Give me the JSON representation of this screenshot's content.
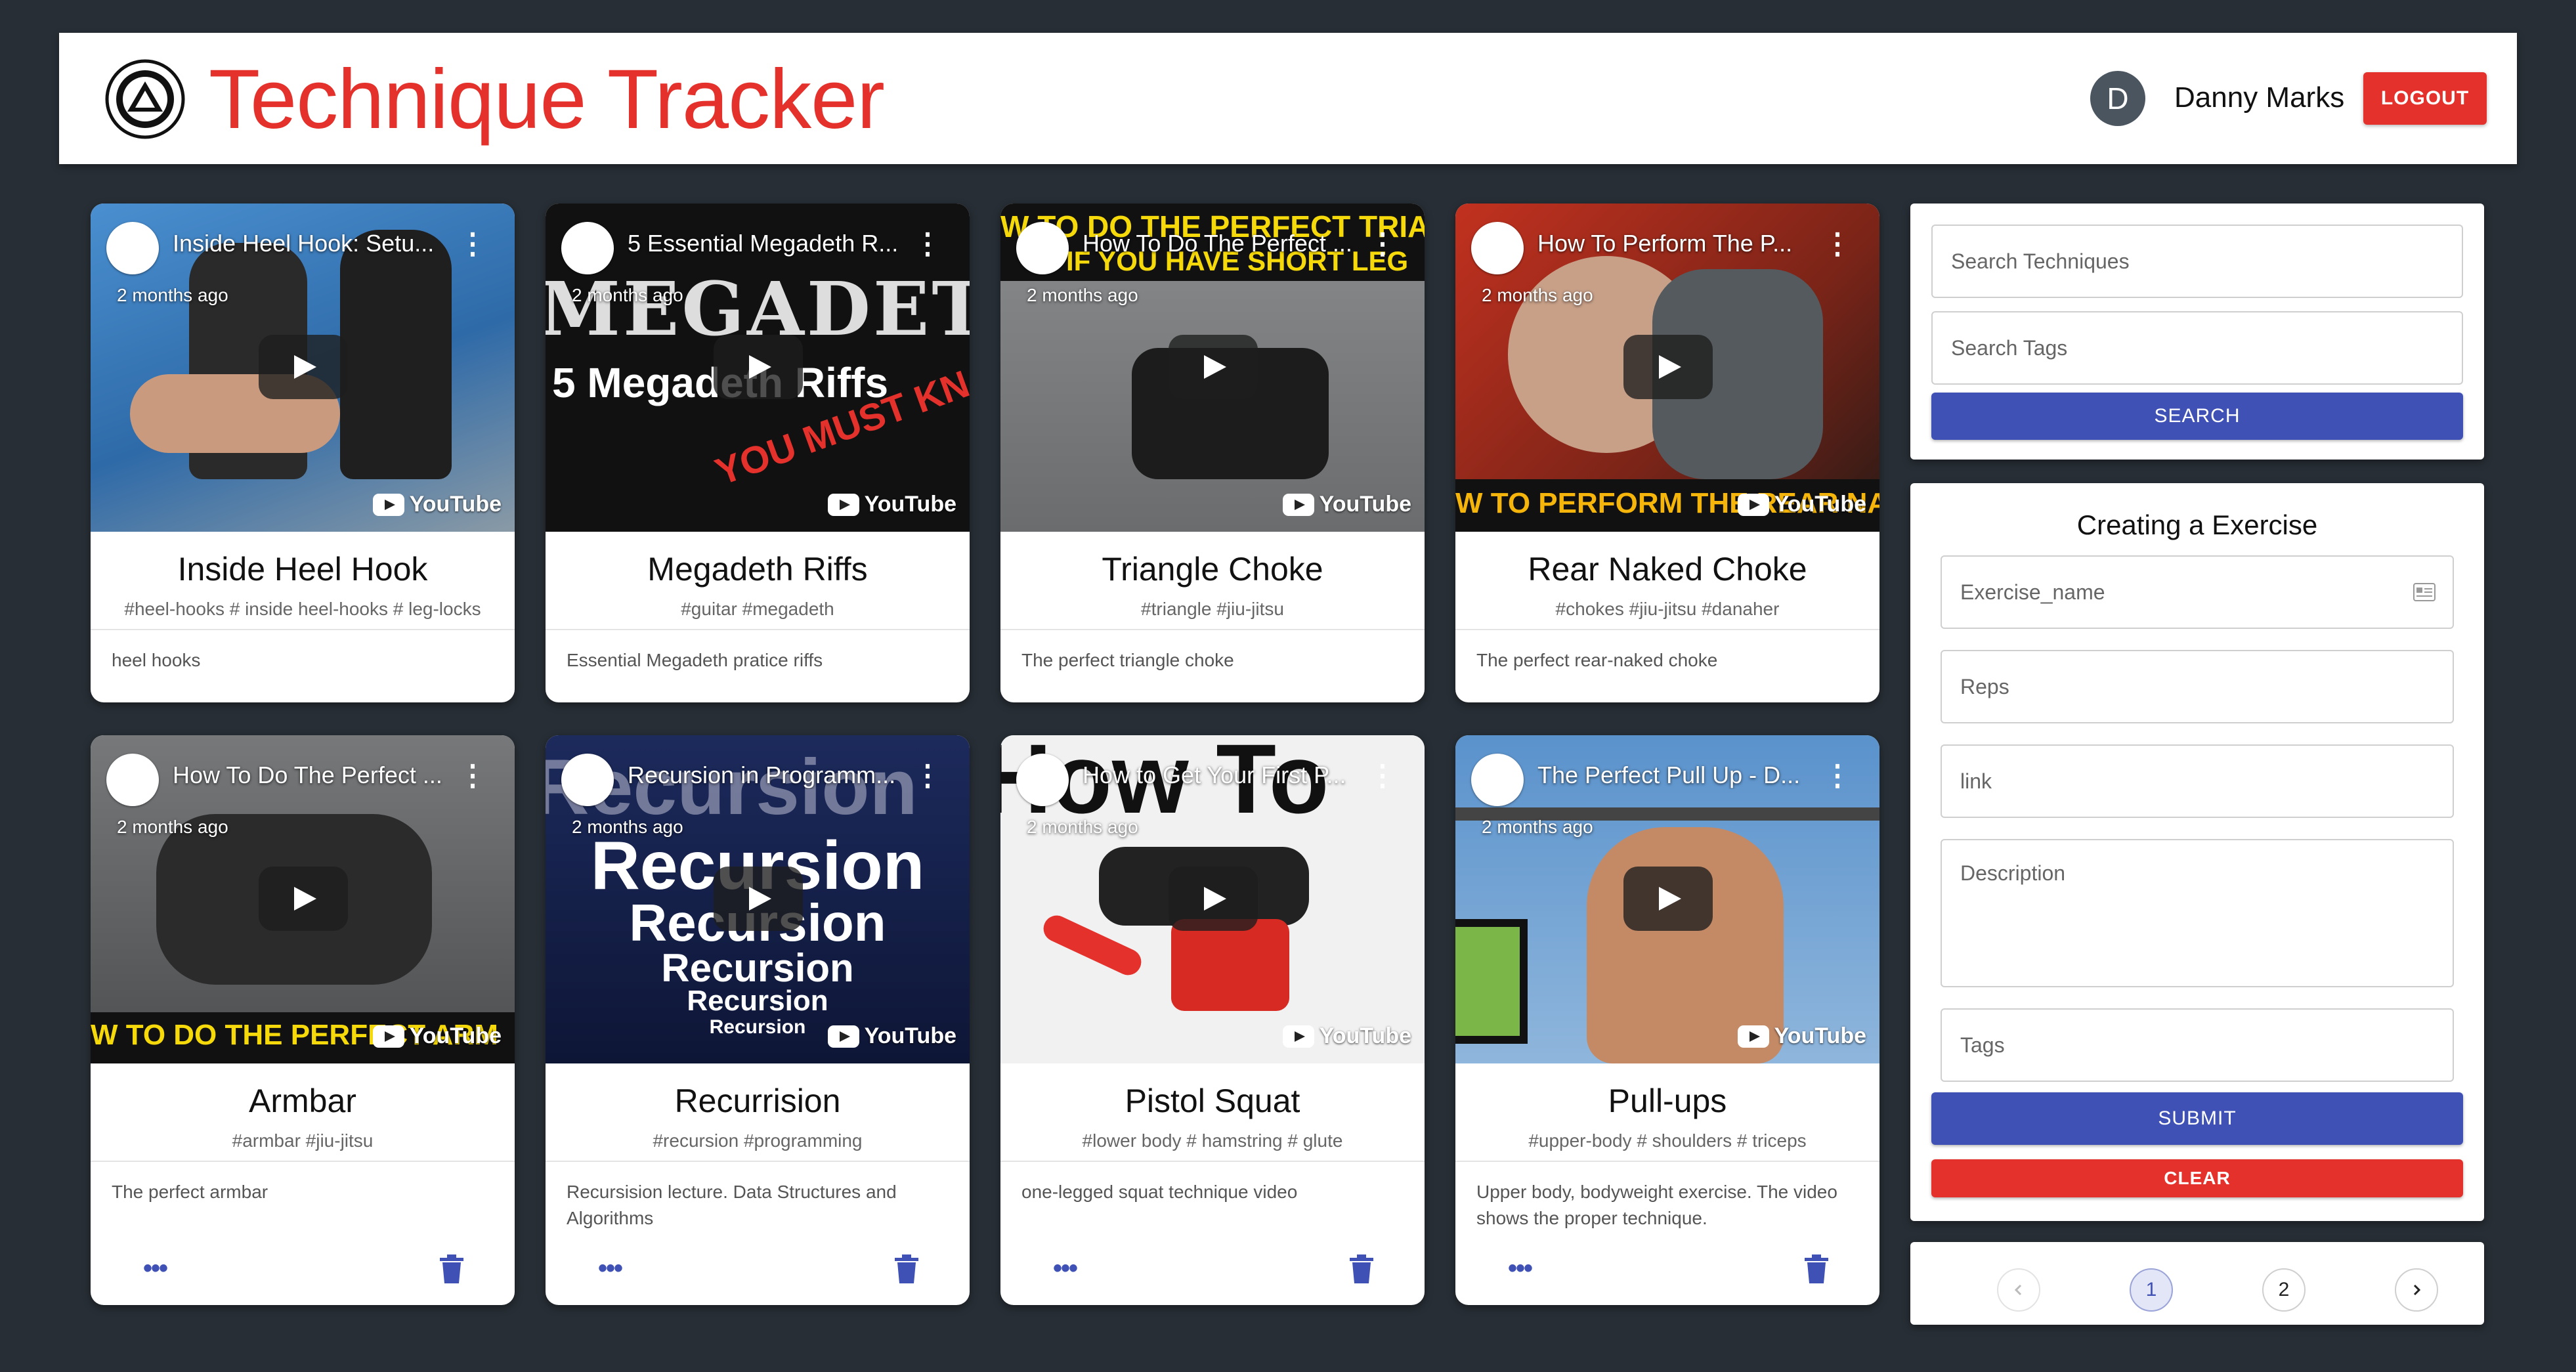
{
  "header": {
    "title": "Technique Tracker",
    "user": {
      "initial": "D",
      "name": "Danny Marks"
    },
    "logout_label": "LOGOUT"
  },
  "cards": [
    {
      "video_title": "Inside Heel Hook: Setu...",
      "video_age": "2 months ago",
      "title": "Inside Heel Hook",
      "tags": "#heel-hooks # inside heel-hooks # leg-locks",
      "description": "heel hooks",
      "bg": "#3f7fbf"
    },
    {
      "video_title": "5 Essential Megadeth R...",
      "video_age": "2 months ago",
      "title": "Megadeth Riffs",
      "tags": "#guitar #megadeth",
      "description": "Essential Megadeth pratice riffs",
      "bg": "#1a1a1a",
      "overlay_big": "MEGADETH",
      "overlay_mid": "5 Megadeth Riffs",
      "overlay_red": "YOU MUST KN"
    },
    {
      "video_title": "How To Do The Perfect ...",
      "video_age": "2 months ago",
      "title": "Triangle Choke",
      "tags": "#triangle #jiu-jitsu",
      "description": "The perfect triangle choke",
      "bg": "#707274",
      "overlay_top1": "W TO DO THE PERFECT TRIAN",
      "overlay_top2": "IF YOU HAVE SHORT LEG"
    },
    {
      "video_title": "How To Perform The P...",
      "video_age": "2 months ago",
      "title": "Rear Naked Choke",
      "tags": "#chokes #jiu-jitsu #danaher",
      "description": "The perfect rear-naked choke",
      "bg": "#7a2418",
      "overlay_bottom": "W TO PERFORM THE REAR NAKED CH"
    },
    {
      "video_title": "How To Do The Perfect ...",
      "video_age": "2 months ago",
      "title": "Armbar",
      "tags": "#armbar #jiu-jitsu",
      "description": "The perfect armbar",
      "bg": "#5e6063",
      "overlay_bottom": "W TO DO THE PERFECT ARM"
    },
    {
      "video_title": "Recursion in Programm...",
      "video_age": "2 months ago",
      "title": "Recurrision",
      "tags": "#recursion #programming",
      "description": "Recursision lecture. Data Structures and Algorithms",
      "bg": "#14204a",
      "overlay_big": "Recursion"
    },
    {
      "video_title": "How to Get Your First P...",
      "video_age": "2 months ago",
      "title": "Pistol Squat",
      "tags": "#lower body # hamstring # glute",
      "description": "one-legged squat technique video",
      "bg": "#f3f3f3",
      "overlay_big": "How To"
    },
    {
      "video_title": "The Perfect Pull Up - D...",
      "video_age": "2 months ago",
      "title": "Pull-ups",
      "tags": "#upper-body # shoulders # triceps",
      "description": "Upper body, bodyweight exercise. The video shows the proper technique.",
      "bg": "#4f86c2"
    }
  ],
  "youtube_label": "YouTube",
  "search": {
    "techniques_placeholder": "Search Techniques",
    "tags_placeholder": "Search Tags",
    "button_label": "SEARCH"
  },
  "form": {
    "title": "Creating a Exercise",
    "exercise_name_placeholder": "Exercise_name",
    "reps_placeholder": "Reps",
    "link_placeholder": "link",
    "description_placeholder": "Description",
    "tags_placeholder": "Tags",
    "submit_label": "SUBMIT",
    "clear_label": "CLEAR"
  },
  "pagination": {
    "pages": [
      "1",
      "2"
    ],
    "current": "1"
  },
  "colors": {
    "accent_red": "#e4312b",
    "accent_blue": "#3f51b5",
    "background": "#272e35"
  }
}
